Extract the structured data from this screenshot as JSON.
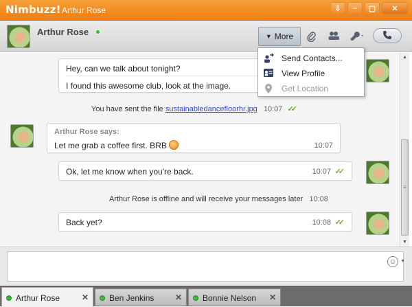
{
  "window": {
    "brand": "Nimbuzz!",
    "title": "Arthur Rose",
    "buttons": [
      "⇩",
      "–",
      "▢",
      "✕"
    ]
  },
  "header": {
    "contact_name": "Arthur Rose",
    "presence": "online",
    "more_label": "More",
    "icons": [
      "paperclip-icon",
      "contacts-icon",
      "wrench-icon",
      "phone-icon"
    ]
  },
  "menu": {
    "items": [
      {
        "label": "Send Contacts...",
        "icon": "send-contacts-icon",
        "enabled": true
      },
      {
        "label": "View Profile",
        "icon": "profile-card-icon",
        "enabled": true
      },
      {
        "label": "Get Location",
        "icon": "location-pin-icon",
        "enabled": false
      }
    ]
  },
  "messages": {
    "m1": {
      "line1": "Hey, can we talk about tonight?",
      "line2": "I found this awesome club, look at the image."
    },
    "file": {
      "prefix": "You have sent the file",
      "filename": "sustainabledancefloorhr.jpg",
      "time": "10:07"
    },
    "m2": {
      "sender": "Arthur Rose says:",
      "text": "Let me grab a coffee first. BRB",
      "time": "10:07"
    },
    "m3": {
      "text": "Ok, let me know when you're back.",
      "time": "10:07"
    },
    "offline": {
      "text": "Arthur Rose  is offline and will receive your messages later",
      "time": "10:08"
    },
    "m4": {
      "text": "Back yet?",
      "time": "10:08"
    }
  },
  "input": {
    "value": "",
    "placeholder": ""
  },
  "tabs": [
    {
      "label": "Arthur Rose",
      "active": true
    },
    {
      "label": "Ben Jenkins",
      "active": false
    },
    {
      "label": "Bonnie Nelson",
      "active": false
    }
  ],
  "colors": {
    "brand_orange": "#ef7d0d",
    "presence_green": "#3db83d",
    "link_blue": "#2a4fd6",
    "tick_green": "#6ab12a"
  }
}
